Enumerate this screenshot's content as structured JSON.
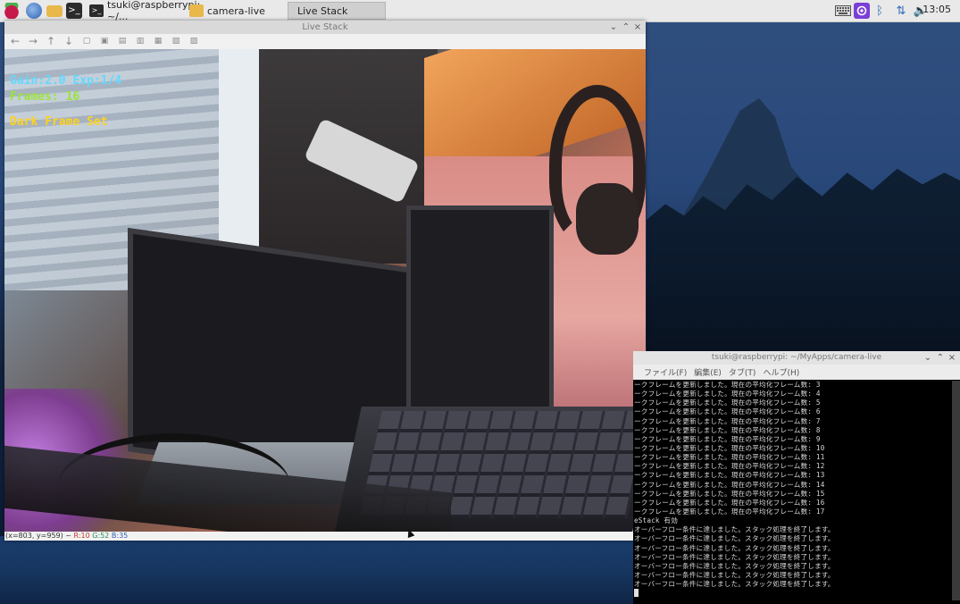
{
  "taskbar": {
    "tasks": [
      {
        "label": "tsuki@raspberrypi: ~/..."
      },
      {
        "label": "camera-live"
      },
      {
        "label": "Live Stack"
      }
    ],
    "clock": "13:05"
  },
  "live_window": {
    "title": "Live Stack",
    "overlay": {
      "gain_exp": "Gain:2.0 Exp:1/4",
      "frames": "Frames: 16",
      "dark": "Dark Frame Set"
    },
    "status": {
      "coords": "(x=803, y=959) ~",
      "r": "R:10",
      "g": "G:52",
      "b": "B:35"
    }
  },
  "terminal": {
    "title": "tsuki@raspberrypi: ~/MyApps/camera-live",
    "menu": [
      "ファイル(F)",
      "編集(E)",
      "タブ(T)",
      "ヘルプ(H)"
    ],
    "lines": [
      "ークフレームを更新しました。現在の平均化フレーム数: 3",
      "ークフレームを更新しました。現在の平均化フレーム数: 4",
      "ークフレームを更新しました。現在の平均化フレーム数: 5",
      "ークフレームを更新しました。現在の平均化フレーム数: 6",
      "ークフレームを更新しました。現在の平均化フレーム数: 7",
      "ークフレームを更新しました。現在の平均化フレーム数: 8",
      "ークフレームを更新しました。現在の平均化フレーム数: 9",
      "ークフレームを更新しました。現在の平均化フレーム数: 10",
      "ークフレームを更新しました。現在の平均化フレーム数: 11",
      "ークフレームを更新しました。現在の平均化フレーム数: 12",
      "ークフレームを更新しました。現在の平均化フレーム数: 13",
      "ークフレームを更新しました。現在の平均化フレーム数: 14",
      "ークフレームを更新しました。現在の平均化フレーム数: 15",
      "ークフレームを更新しました。現在の平均化フレーム数: 16",
      "ークフレームを更新しました。現在の平均化フレーム数: 17",
      "eStack 有効",
      "オーバーフロー条件に達しました。スタック処理を終了します。",
      "オーバーフロー条件に達しました。スタック処理を終了します。",
      "オーバーフロー条件に達しました。スタック処理を終了します。",
      "オーバーフロー条件に達しました。スタック処理を終了します。",
      "オーバーフロー条件に達しました。スタック処理を終了します。",
      "オーバーフロー条件に達しました。スタック処理を終了します。",
      "オーバーフロー条件に達しました。スタック処理を終了します。"
    ]
  },
  "colors": {
    "overlay_cyan": "#63d8ff",
    "overlay_green": "#9be23d",
    "overlay_yellow": "#ffd21f"
  },
  "icons": {
    "taskbar": [
      "raspberry-icon",
      "globe-icon",
      "folder-icon",
      "terminal-icon"
    ],
    "tray": [
      "keyboard-icon",
      "app-indicator-icon",
      "bluetooth-icon",
      "network-arrows-icon",
      "volume-icon"
    ],
    "toolbar": [
      "arrow-left-icon",
      "arrow-right-icon",
      "arrow-up-icon",
      "arrow-down-icon",
      "zoom-icon",
      "save-icon",
      "copy-icon",
      "paste-icon",
      "properties-icon",
      "export-icon",
      "settings-icon"
    ]
  }
}
